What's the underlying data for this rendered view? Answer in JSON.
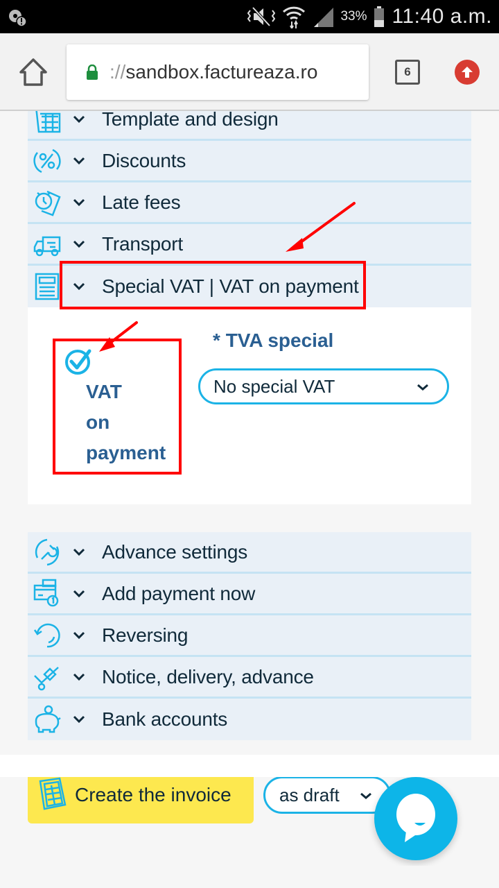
{
  "status_bar": {
    "battery_percent": "33%",
    "time": "11:40 a.m.",
    "icons": [
      "notification-alert-icon",
      "vibrate-mute-icon",
      "wifi-icon",
      "signal-icon",
      "battery-icon"
    ]
  },
  "browser": {
    "url_scheme": "://",
    "url_host": "sandbox.factureaza.ro",
    "tab_count": "6",
    "icons": [
      "home-icon",
      "lock-icon",
      "tabs-icon",
      "update-icon"
    ]
  },
  "accordion_top": [
    {
      "label": "Template and design",
      "icon": "template-icon"
    },
    {
      "label": "Discounts",
      "icon": "discount-icon"
    },
    {
      "label": "Late fees",
      "icon": "late-fees-icon"
    },
    {
      "label": "Transport",
      "icon": "truck-icon"
    },
    {
      "label": "Special VAT | VAT on payment",
      "icon": "calculator-icon"
    }
  ],
  "special_vat": {
    "checkbox_label_lines": [
      "VAT",
      "on",
      "payment"
    ],
    "checkbox_checked": true,
    "tva_required_marker": "*",
    "tva_label": "TVA special",
    "tva_selected": "No special VAT"
  },
  "accordion_bottom": [
    {
      "label": "Advance settings",
      "icon": "wrench-icon"
    },
    {
      "label": "Add payment now",
      "icon": "payment-icon"
    },
    {
      "label": "Reversing",
      "icon": "reverse-icon"
    },
    {
      "label": "Notice, delivery, advance",
      "icon": "hand-truck-icon"
    },
    {
      "label": "Bank accounts",
      "icon": "piggy-bank-icon"
    }
  ],
  "footer": {
    "create_label": "Create the invoice",
    "save_mode": "as draft"
  },
  "colors": {
    "accent": "#1bb3e6",
    "label_blue": "#2a5f92",
    "panel_bg": "#e9f0f7",
    "create_button": "#fde84f",
    "annotation_red": "#ff0000"
  }
}
